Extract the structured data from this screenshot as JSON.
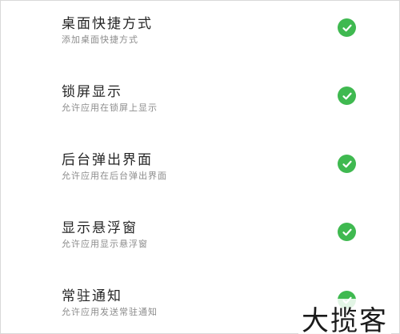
{
  "settings": {
    "items": [
      {
        "title": "桌面快捷方式",
        "subtitle": "添加桌面快捷方式",
        "checked": true
      },
      {
        "title": "锁屏显示",
        "subtitle": "允许应用在锁屏上显示",
        "checked": true
      },
      {
        "title": "后台弹出界面",
        "subtitle": "允许应用在后台弹出界面",
        "checked": true
      },
      {
        "title": "显示悬浮窗",
        "subtitle": "允许应用显示悬浮窗",
        "checked": true
      },
      {
        "title": "常驻通知",
        "subtitle": "允许应用发送常驻通知",
        "checked": true
      }
    ],
    "check_color": "#3fb950"
  },
  "watermark": {
    "text": "大揽客"
  }
}
